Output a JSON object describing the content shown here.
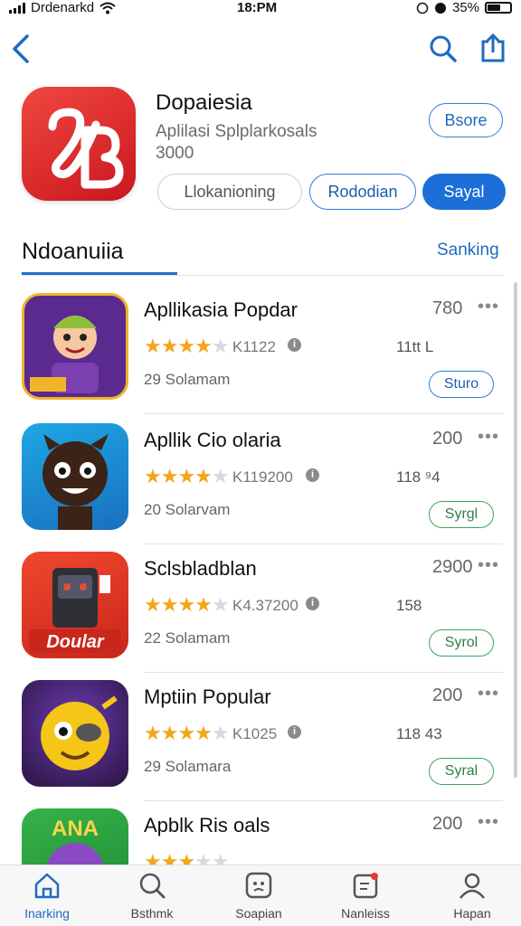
{
  "status_bar": {
    "carrier": "Drdenarkd",
    "time": "18:PM",
    "battery": "35%"
  },
  "header_app": {
    "title": "Dopaiesia",
    "subtitle": "Aplilasi Splplarkosals",
    "count": "3000",
    "side_button": "Bsore",
    "buttons": [
      "Llokanioning",
      "Rododian",
      "Sayal"
    ]
  },
  "section": {
    "title": "Ndoanuiia",
    "link": "Sanking"
  },
  "apps": [
    {
      "name": "Apllikasia Popdar",
      "rating": 4,
      "reviews": "K1122",
      "size": "11tt  L",
      "subtitle": "29 Solamam",
      "price": "780",
      "action": "Sturo",
      "action_color": "blue"
    },
    {
      "name": "Apllik Cio olaria",
      "rating": 4,
      "reviews": "K119200",
      "size": "118  ⁹4",
      "subtitle": "20 Solarvam",
      "price": "200",
      "action": "Syrgl",
      "action_color": "green"
    },
    {
      "name": "Sclsbladblan",
      "rating": 4,
      "reviews": "K4.37200",
      "size": "158",
      "subtitle": "22 Solamam",
      "price": "2900",
      "action": "Syrol",
      "action_color": "green"
    },
    {
      "name": "Mptiin Popular",
      "rating": 4,
      "reviews": "K1025",
      "size": "118  43",
      "subtitle": "29 Solamara",
      "price": "200",
      "action": "Syral",
      "action_color": "green"
    },
    {
      "name": "Apblk Ris oals",
      "rating": 3,
      "reviews": "",
      "size": "",
      "subtitle": "",
      "price": "200",
      "action": "",
      "action_color": "green"
    }
  ],
  "tabs": [
    {
      "label": "Inarking",
      "icon": "home-icon"
    },
    {
      "label": "Bsthmk",
      "icon": "search-icon"
    },
    {
      "label": "Soapian",
      "icon": "games-icon"
    },
    {
      "label": "Nanleiss",
      "icon": "updates-icon"
    },
    {
      "label": "Hapan",
      "icon": "profile-icon"
    }
  ],
  "colors": {
    "accent": "#1c6fd8",
    "star": "#f3a51b",
    "green": "#3aa55a",
    "red": "#d42027"
  }
}
